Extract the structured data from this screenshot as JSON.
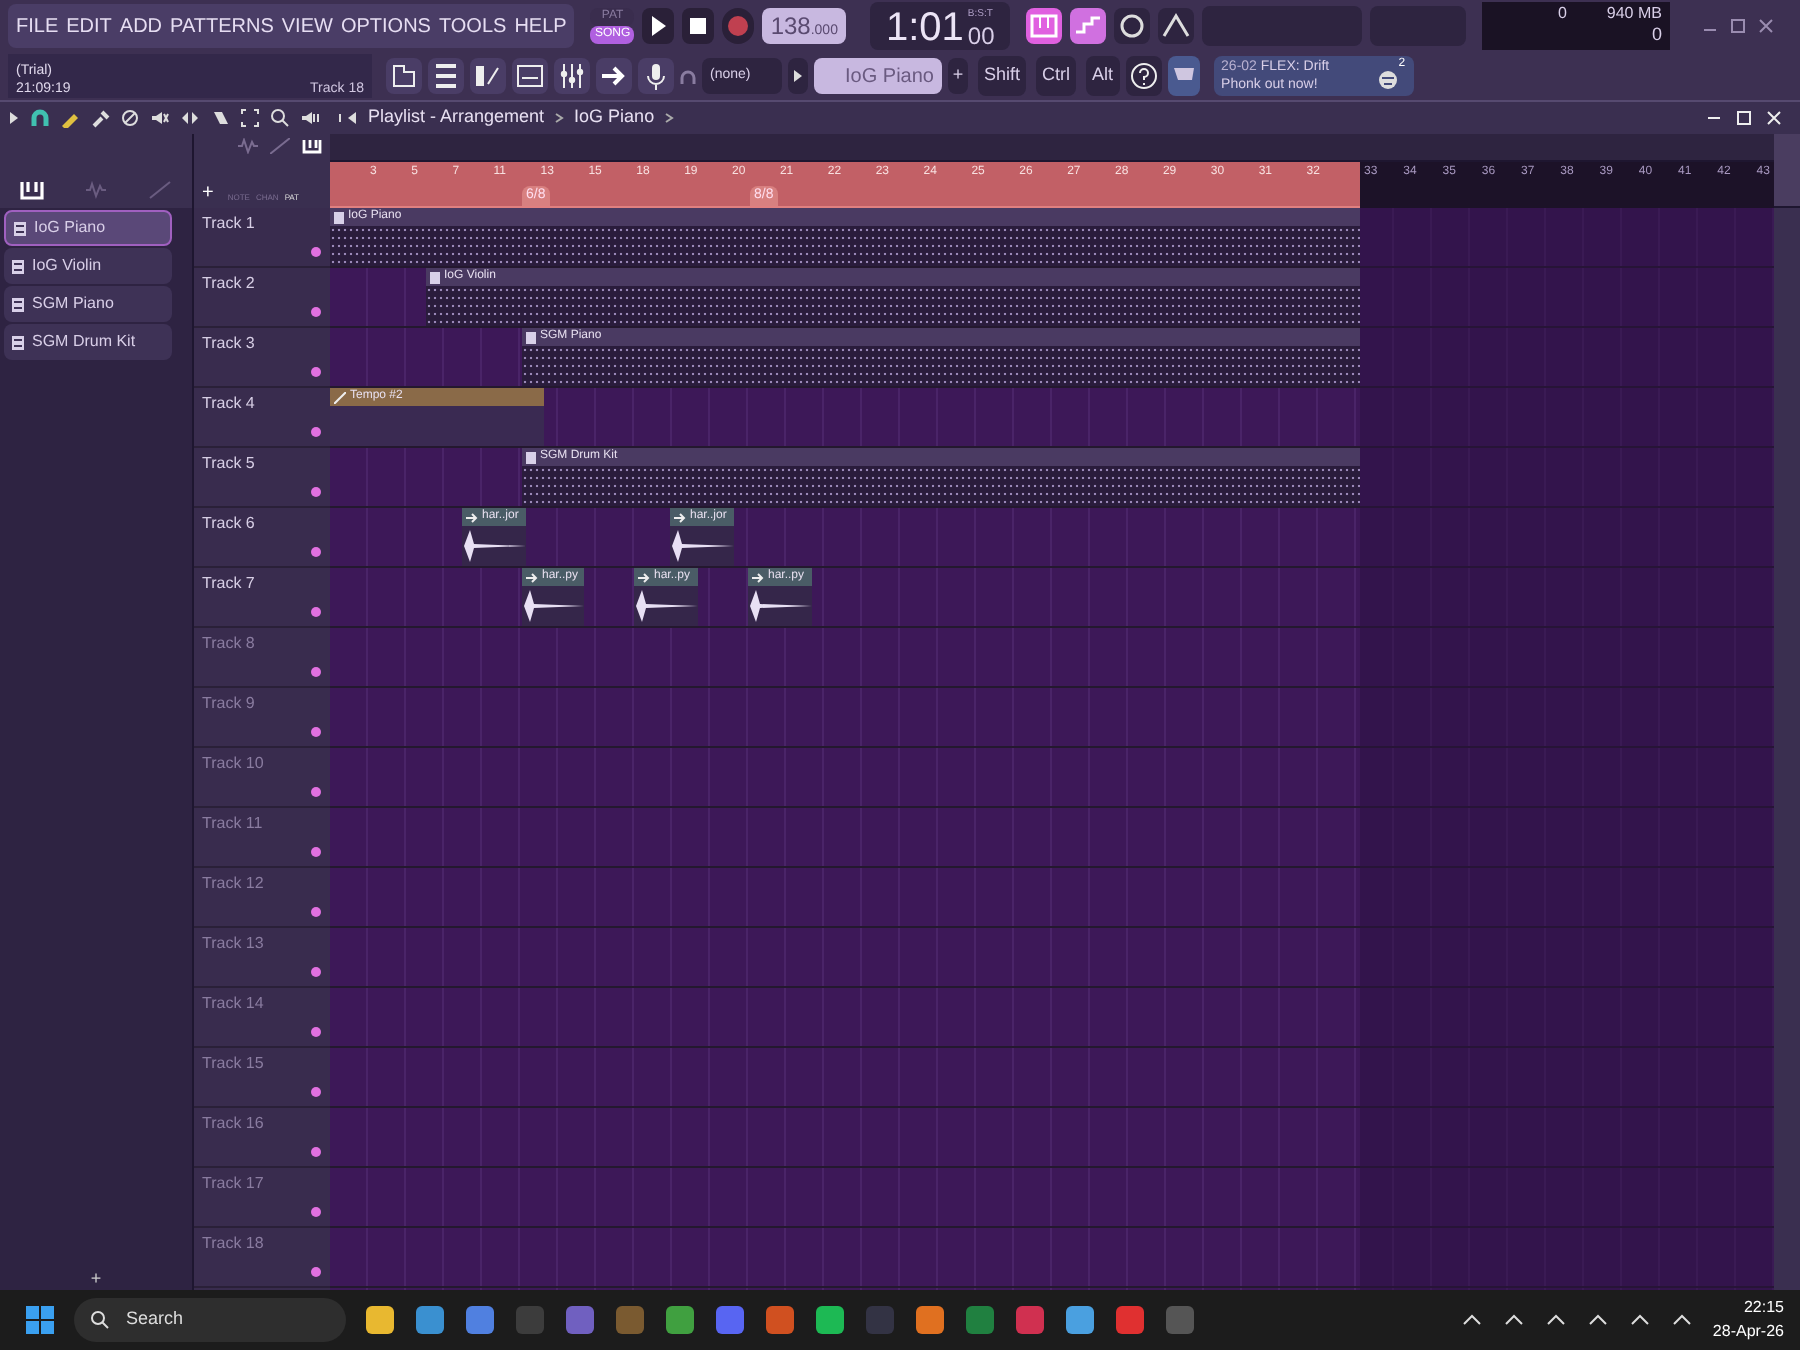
{
  "menu": [
    "FILE",
    "EDIT",
    "ADD",
    "PATTERNS",
    "VIEW",
    "OPTIONS",
    "TOOLS",
    "HELP"
  ],
  "transport": {
    "modes": [
      {
        "label": "PAT",
        "selected": false
      },
      {
        "label": "SONG",
        "selected": true
      }
    ],
    "recording": false,
    "tempo": "138",
    "tempo_fraction": ".000",
    "time": "1:01",
    "time_ticks": "00",
    "time_format": "B:S:T"
  },
  "monitor": {
    "cpu": "0",
    "memory": "940 MB",
    "polyphony": "0"
  },
  "hint": {
    "lines": [
      "(Trial)",
      "21:09:19"
    ],
    "target": "Track 18"
  },
  "pattern_selector": {
    "channel": "(none)",
    "pattern": "IoG Piano",
    "add": "+"
  },
  "modifier_keys": [
    "Shift",
    "Ctrl",
    "Alt"
  ],
  "news": {
    "date": "26-02",
    "text": "FLEX: Drift Phonk out now!",
    "count": "2"
  },
  "playlist": {
    "breadcrumb": [
      "Playlist - Arrangement",
      "IoG Piano"
    ],
    "picker": [
      {
        "label": "IoG Piano",
        "selected": true
      },
      {
        "label": "IoG Violin",
        "selected": false
      },
      {
        "label": "SGM Piano",
        "selected": false
      },
      {
        "label": "SGM Drum Kit",
        "selected": false
      }
    ],
    "picker_add": "+",
    "add_track": "+",
    "picker_tabs": [
      "NOTE",
      "CHAN",
      "PAT"
    ],
    "ruler": {
      "song_bars": [
        "3",
        "5",
        "7",
        "11",
        "13",
        "15",
        "18",
        "19",
        "20",
        "21",
        "22",
        "23",
        "24",
        "25",
        "26",
        "27",
        "28",
        "29",
        "30",
        "31",
        "32"
      ],
      "bars": [
        "33",
        "34",
        "35",
        "36",
        "37",
        "38",
        "39",
        "40",
        "41",
        "42",
        "43"
      ],
      "markers": [
        "6/8",
        "8/8"
      ]
    },
    "tracks": [
      {
        "name": "Track 1",
        "dimmed": false,
        "clips": [
          {
            "kind": "pattern",
            "label": "IoG Piano"
          }
        ]
      },
      {
        "name": "Track 2",
        "dimmed": false,
        "clips": [
          {
            "kind": "pattern",
            "label": "IoG Violin"
          }
        ]
      },
      {
        "name": "Track 3",
        "dimmed": false,
        "clips": [
          {
            "kind": "pattern",
            "label": "SGM Piano"
          }
        ]
      },
      {
        "name": "Track 4",
        "dimmed": false,
        "clips": [
          {
            "kind": "automation",
            "label": "Tempo #2"
          }
        ]
      },
      {
        "name": "Track 5",
        "dimmed": false,
        "clips": [
          {
            "kind": "drums",
            "label": "SGM Drum Kit"
          }
        ]
      },
      {
        "name": "Track 6",
        "dimmed": false,
        "clips": [
          {
            "kind": "audio",
            "label": "har..jor"
          },
          {
            "kind": "audio",
            "label": "har..jor"
          }
        ]
      },
      {
        "name": "Track 7",
        "dimmed": false,
        "clips": [
          {
            "kind": "audio",
            "label": "har..py"
          },
          {
            "kind": "audio",
            "label": "har..py"
          },
          {
            "kind": "audio",
            "label": "har..py"
          }
        ]
      },
      {
        "name": "Track 8",
        "dimmed": true
      },
      {
        "name": "Track 9",
        "dimmed": true
      },
      {
        "name": "Track 10",
        "dimmed": true
      },
      {
        "name": "Track 11",
        "dimmed": true
      },
      {
        "name": "Track 12",
        "dimmed": true
      },
      {
        "name": "Track 13",
        "dimmed": true
      },
      {
        "name": "Track 14",
        "dimmed": true
      },
      {
        "name": "Track 15",
        "dimmed": true
      },
      {
        "name": "Track 16",
        "dimmed": true
      },
      {
        "name": "Track 17",
        "dimmed": true
      },
      {
        "name": "Track 18",
        "dimmed": true
      }
    ]
  },
  "taskbar": {
    "search": "Search",
    "time": "22:15",
    "date": "28-Apr-26"
  }
}
